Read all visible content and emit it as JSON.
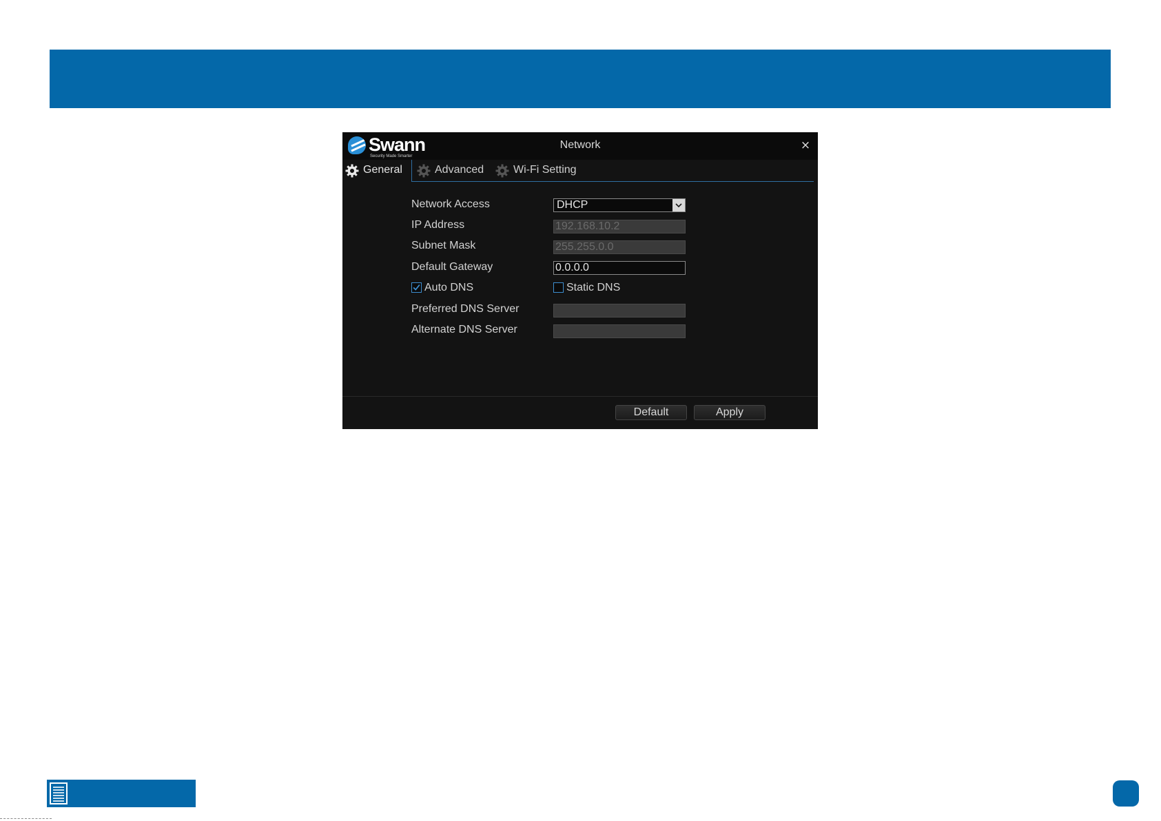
{
  "brand": {
    "name": "Swann",
    "tagline": "Security Made Smarter"
  },
  "window": {
    "title": "Network",
    "close_label": "×"
  },
  "tabs": [
    {
      "label": "General",
      "active": true
    },
    {
      "label": "Advanced",
      "active": false
    },
    {
      "label": "Wi-Fi Setting",
      "active": false
    }
  ],
  "form": {
    "network_access": {
      "label": "Network Access",
      "value": "DHCP"
    },
    "ip_address": {
      "label": "IP Address",
      "value": "192.168.10.2"
    },
    "subnet_mask": {
      "label": "Subnet Mask",
      "value": "255.255.0.0"
    },
    "default_gateway": {
      "label": "Default Gateway",
      "value": "0.0.0.0"
    },
    "auto_dns": {
      "label": "Auto DNS",
      "checked": true
    },
    "static_dns": {
      "label": "Static DNS",
      "checked": false
    },
    "preferred_dns": {
      "label": "Preferred DNS Server",
      "value": ""
    },
    "alternate_dns": {
      "label": "Alternate DNS Server",
      "value": ""
    }
  },
  "buttons": {
    "default_label": "Default",
    "apply_label": "Apply"
  },
  "colors": {
    "banner": "#0468a9",
    "window_bg": "#131313",
    "accent": "#3d8ed0"
  },
  "icons": {
    "tab_icon": "gear-icon",
    "footer_icon": "document-icon",
    "dropdown_icon": "chevron-down-icon",
    "check_icon": "checkmark-icon"
  }
}
